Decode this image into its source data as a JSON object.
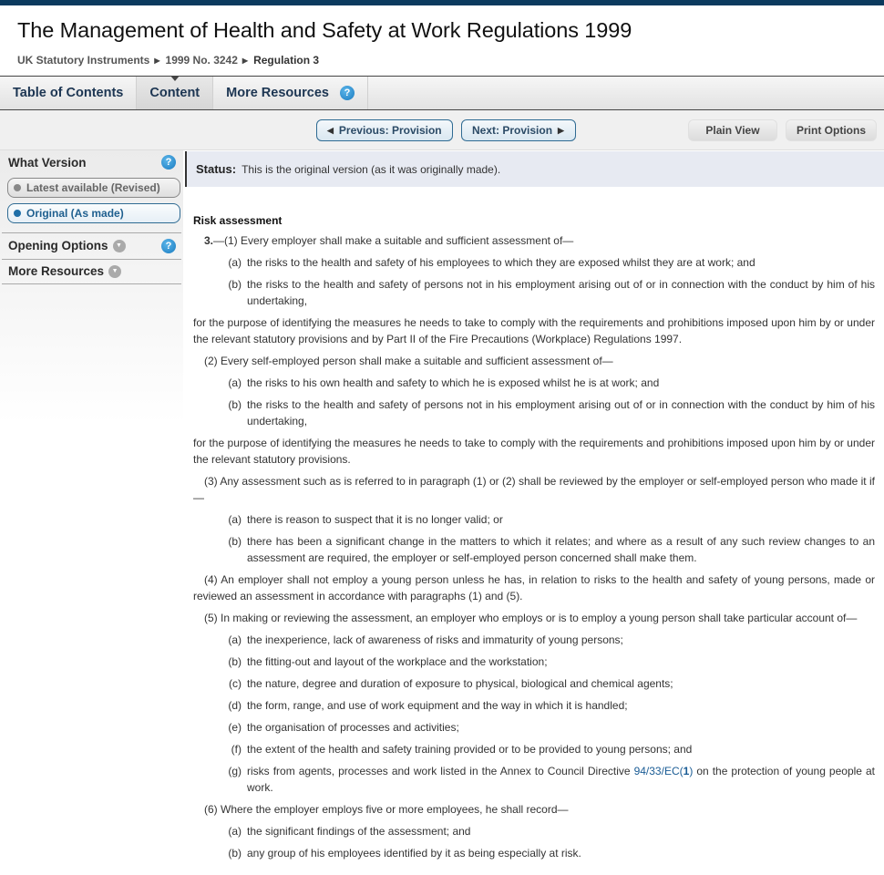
{
  "header": {
    "title": "The Management of Health and Safety at Work Regulations 1999",
    "breadcrumb": [
      {
        "label": "UK Statutory Instruments"
      },
      {
        "label": "1999 No. 3242"
      },
      {
        "label": "Regulation 3"
      }
    ],
    "separator": "▶"
  },
  "tabs": [
    {
      "label": "Table of Contents"
    },
    {
      "label": "Content",
      "active": true
    },
    {
      "label": "More Resources",
      "help": "?"
    }
  ],
  "toolbar": {
    "prev_label": "Previous: Provision",
    "next_label": "Next: Provision",
    "plain_view": "Plain View",
    "print_options": "Print Options",
    "prev_icon": "◀",
    "next_icon": "▶"
  },
  "sidebar": {
    "what_version": "What Version",
    "help": "?",
    "versions": [
      {
        "label": "Latest available (Revised)",
        "selected": false
      },
      {
        "label": "Original (As made)",
        "selected": true
      }
    ],
    "opening_options": "Opening Options",
    "more_resources": "More Resources",
    "chevron": "▼"
  },
  "status": {
    "label": "Status:",
    "text": "This is the original version (as it was originally made)."
  },
  "content": {
    "heading": "Risk assessment",
    "p1_num": "3.",
    "p1": "—(1) Every employer shall make a suitable and sufficient assessment of—",
    "p1_items": [
      {
        "label": "(a)",
        "text": "the risks to the health and safety of his employees to which they are exposed whilst they are at work; and"
      },
      {
        "label": "(b)",
        "text": "the risks to the health and safety of persons not in his employment arising out of or in connection with the conduct by him of his undertaking,"
      }
    ],
    "p1_tail": "for the purpose of identifying the measures he needs to take to comply with the requirements and prohibitions imposed upon him by or under the relevant statutory provisions and by Part II of the Fire Precautions (Workplace) Regulations 1997.",
    "p2": "(2) Every self-employed person shall make a suitable and sufficient assessment of—",
    "p2_items": [
      {
        "label": "(a)",
        "text": "the risks to his own health and safety to which he is exposed whilst he is at work; and"
      },
      {
        "label": "(b)",
        "text": "the risks to the health and safety of persons not in his employment arising out of or in connection with the conduct by him of his undertaking,"
      }
    ],
    "p2_tail": "for the purpose of identifying the measures he needs to take to comply with the requirements and prohibitions imposed upon him by or under the relevant statutory provisions.",
    "p3": "(3) Any assessment such as is referred to in paragraph (1) or (2) shall be reviewed by the employer or self-employed person who made it if—",
    "p3_items": [
      {
        "label": "(a)",
        "text": "there is reason to suspect that it is no longer valid; or"
      },
      {
        "label": "(b)",
        "text": "there has been a significant change in the matters to which it relates; and where as a result of any such review changes to an assessment are required, the employer or self-employed person concerned shall make them."
      }
    ],
    "p4": "(4) An employer shall not employ a young person unless he has, in relation to risks to the health and safety of young persons, made or reviewed an assessment in accordance with paragraphs (1) and (5).",
    "p5": "(5) In making or reviewing the assessment, an employer who employs or is to employ a young person shall take particular account of—",
    "p5_items": [
      {
        "label": "(a)",
        "text": "the inexperience, lack of awareness of risks and immaturity of young persons;"
      },
      {
        "label": "(b)",
        "text": "the fitting-out and layout of the workplace and the workstation;"
      },
      {
        "label": "(c)",
        "text": "the nature, degree and duration of exposure to physical, biological and chemical agents;"
      },
      {
        "label": "(d)",
        "text": "the form, range, and use of work equipment and the way in which it is handled;"
      },
      {
        "label": "(e)",
        "text": "the organisation of processes and activities;"
      },
      {
        "label": "(f)",
        "text": "the extent of the health and safety training provided or to be provided to young persons; and"
      }
    ],
    "p5_g_label": "(g)",
    "p5_g_before": "risks from agents, processes and work listed in the Annex to Council Directive ",
    "p5_g_link": "94/33/EC",
    "p5_g_fn_open": "(",
    "p5_g_fn": "1",
    "p5_g_fn_close": ")",
    "p5_g_after": " on the protection of young people at work.",
    "p6": "(6) Where the employer employs five or more employees, he shall record—",
    "p6_items": [
      {
        "label": "(a)",
        "text": "the significant findings of the assessment; and"
      },
      {
        "label": "(b)",
        "text": "any group of his employees identified by it as being especially at risk."
      }
    ]
  },
  "colors": {
    "topbar": "#0b3a5e",
    "link": "#1a5c95",
    "help_icon": "#1a7bc0",
    "status_bg": "#e7eaf2"
  }
}
